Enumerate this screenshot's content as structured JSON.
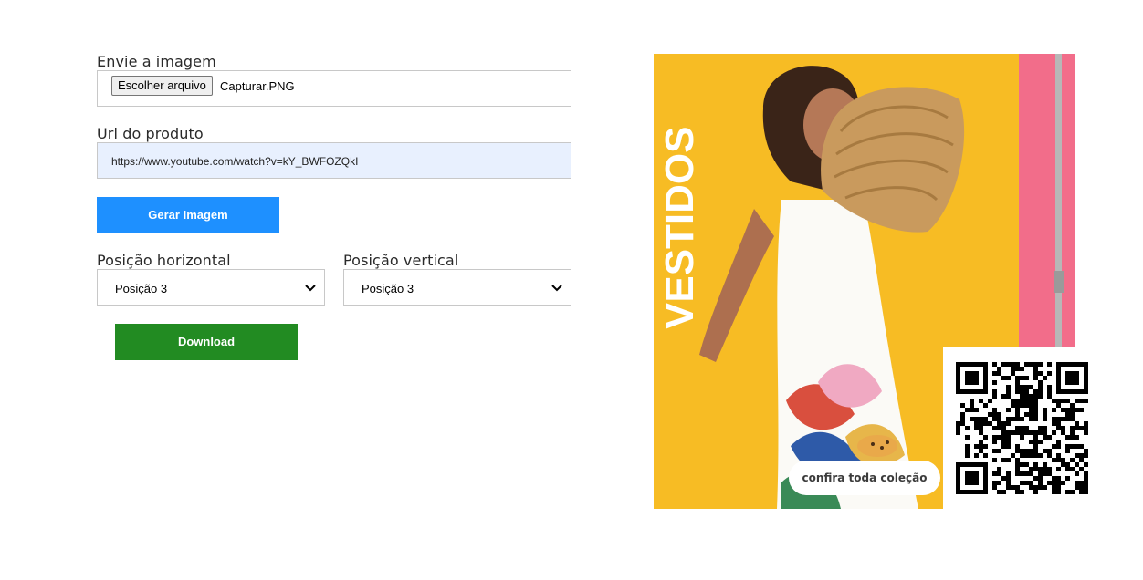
{
  "form": {
    "upload_label": "Envie a imagem",
    "file_button": "Escolher arquivo",
    "file_name": "Capturar.PNG",
    "url_label": "Url do produto",
    "url_value": "https://www.youtube.com/watch?v=kY_BWFOZQkI",
    "generate_button": "Gerar Imagem",
    "horizontal_label": "Posição horizontal",
    "horizontal_value": "Posição 3",
    "vertical_label": "Posição vertical",
    "vertical_value": "Posição 3",
    "download_button": "Download"
  },
  "preview": {
    "banner_word": "VESTIDOS",
    "cta_text": "confira toda coleção"
  },
  "colors": {
    "generate": "#1e90ff",
    "download": "#228b22",
    "banner_yellow": "#f6b71c",
    "banner_pink": "#f26d8a"
  }
}
